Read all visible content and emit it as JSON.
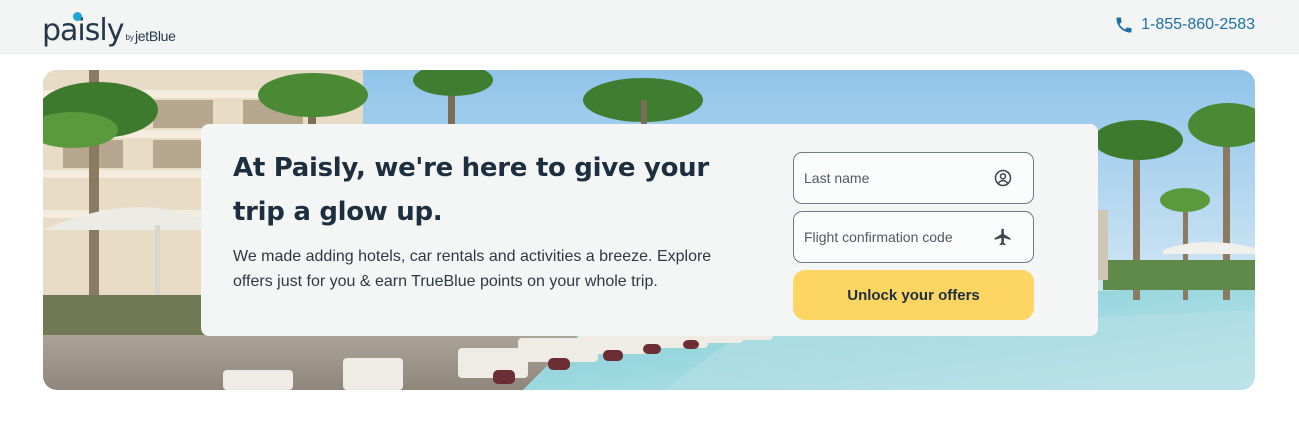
{
  "header": {
    "logo_main": "paisly",
    "logo_by": "by",
    "logo_brand": "jetBlue",
    "phone_number": "1-855-860-2583"
  },
  "hero": {
    "headline": "At Paisly, we're here to give your trip a glow up.",
    "description": "We made adding hotels, car rentals and activities a breeze. Explore offers just for you & earn TrueBlue points on your whole trip.",
    "last_name_placeholder": "Last name",
    "last_name_icon": "user-circle-icon",
    "confirmation_placeholder": "Flight confirmation code",
    "confirmation_icon": "airplane-icon",
    "unlock_label": "Unlock your offers"
  },
  "colors": {
    "brand_navy": "#25384a",
    "accent_blue": "#1f6fa3",
    "logo_dot": "#1ea6d8",
    "cta_yellow": "#fdd562",
    "card_bg": "#f4f6f6",
    "header_bg": "#f3f5f5"
  }
}
